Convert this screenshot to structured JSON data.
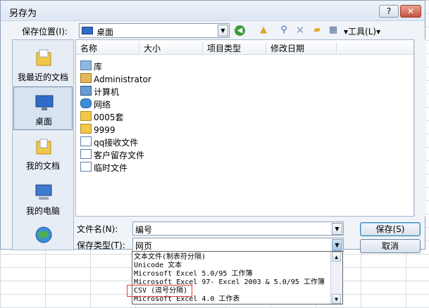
{
  "window": {
    "title": "另存为",
    "help_label": "?",
    "close_label": "✕"
  },
  "location": {
    "label": "保存位置(I):",
    "value": "桌面"
  },
  "toolbar": {
    "tools_label": "▾工具(L)▾"
  },
  "places": [
    {
      "label": "我最近的文档",
      "icon": "recent-documents-icon"
    },
    {
      "label": "桌面",
      "icon": "desktop-icon",
      "selected": true
    },
    {
      "label": "我的文档",
      "icon": "my-documents-icon"
    },
    {
      "label": "我的电脑",
      "icon": "my-computer-icon"
    }
  ],
  "file_list": {
    "columns": [
      "名称",
      "大小",
      "项目类型",
      "修改日期"
    ],
    "items": [
      {
        "name": "库",
        "icon": "library-icon"
      },
      {
        "name": "Administrator",
        "icon": "user-folder-icon"
      },
      {
        "name": "计算机",
        "icon": "computer-icon"
      },
      {
        "name": "网络",
        "icon": "network-icon"
      },
      {
        "name": "0005套",
        "icon": "folder-icon"
      },
      {
        "name": "9999",
        "icon": "folder-icon"
      },
      {
        "name": "qq接收文件",
        "icon": "shortcut-icon"
      },
      {
        "name": "客户留存文件",
        "icon": "shortcut-icon"
      },
      {
        "name": "临时文件",
        "icon": "shortcut-icon"
      }
    ]
  },
  "filename": {
    "label": "文件名(N):",
    "value": "编号"
  },
  "filetype": {
    "label": "保存类型(T):",
    "value": "网页",
    "options": [
      "文本文件(制表符分隔)",
      "Unicode 文本",
      "Microsoft Excel 5.0/95 工作簿",
      "Microsoft Excel 97- Excel 2003 & 5.0/95 工作簿",
      "CSV (逗号分隔)",
      "Microsoft Excel 4.0 工作表"
    ],
    "highlighted": "CSV (逗号分隔)"
  },
  "buttons": {
    "save": "保存(S)",
    "cancel": "取消"
  },
  "colors": {
    "accent": "#2f6cc7",
    "highlight_border": "#e23b3b"
  }
}
